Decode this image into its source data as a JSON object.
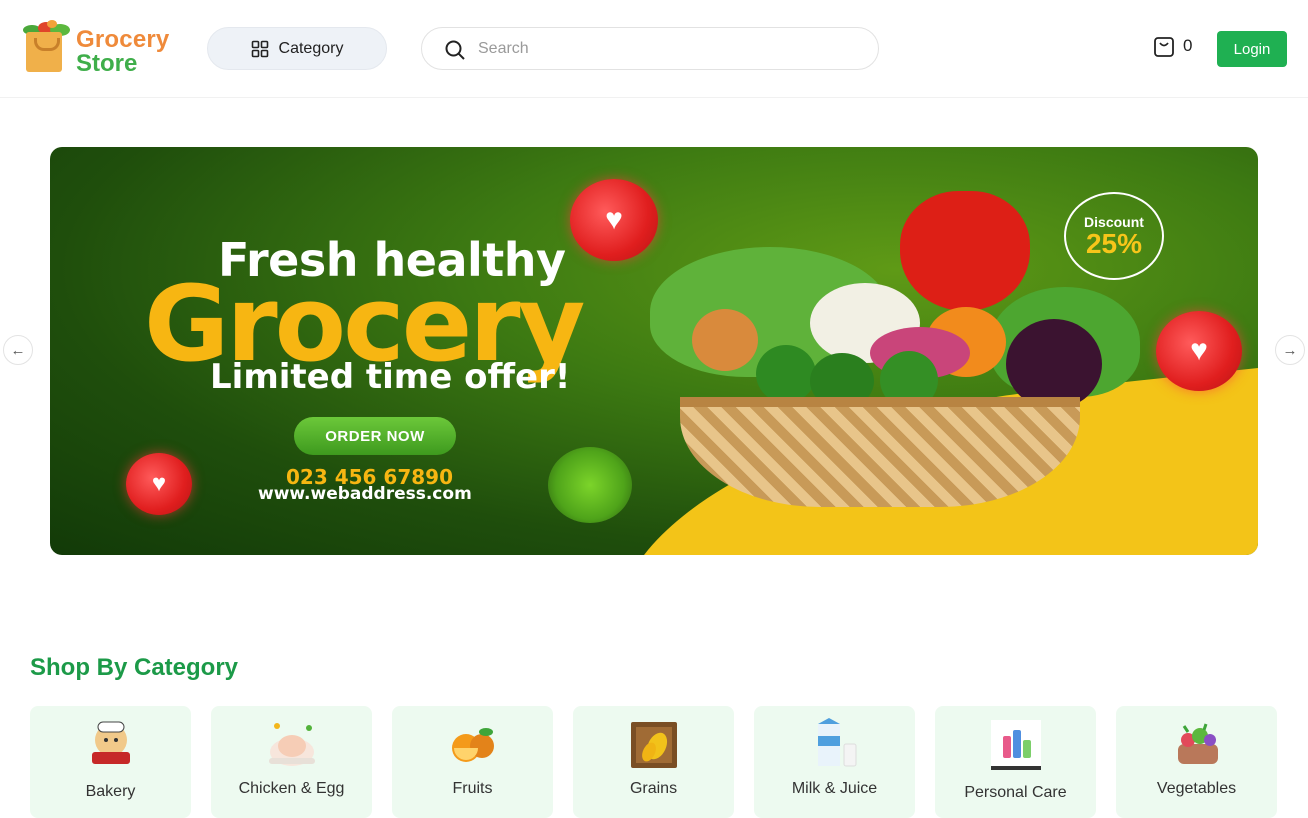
{
  "header": {
    "logo_line1": "Grocery",
    "logo_line2": "Store",
    "category_label": "Category",
    "search_placeholder": "Search",
    "cart_count": "0",
    "login_label": "Login"
  },
  "banner": {
    "headline1": "Fresh healthy",
    "headline2": "Grocery",
    "headline3": "Limited time offer!",
    "cta": "ORDER NOW",
    "phone": "023 456 67890",
    "website": "www.webaddress.com",
    "discount_label": "Discount",
    "discount_value": "25%"
  },
  "categories": {
    "title": "Shop By Category",
    "items": [
      {
        "label": "Bakery",
        "icon": "bakery-icon"
      },
      {
        "label": "Chicken & Egg",
        "icon": "chicken-icon"
      },
      {
        "label": "Fruits",
        "icon": "fruits-icon"
      },
      {
        "label": "Grains",
        "icon": "grains-icon"
      },
      {
        "label": "Milk & Juice",
        "icon": "milk-icon"
      },
      {
        "label": "Personal Care",
        "icon": "personal-care-icon"
      },
      {
        "label": "Vegetables",
        "icon": "vegetables-icon"
      }
    ]
  },
  "colors": {
    "brand_green": "#1fb052",
    "title_green": "#1c9a48",
    "logo_orange": "#ef8a3a",
    "card_bg": "#edfaf0"
  }
}
